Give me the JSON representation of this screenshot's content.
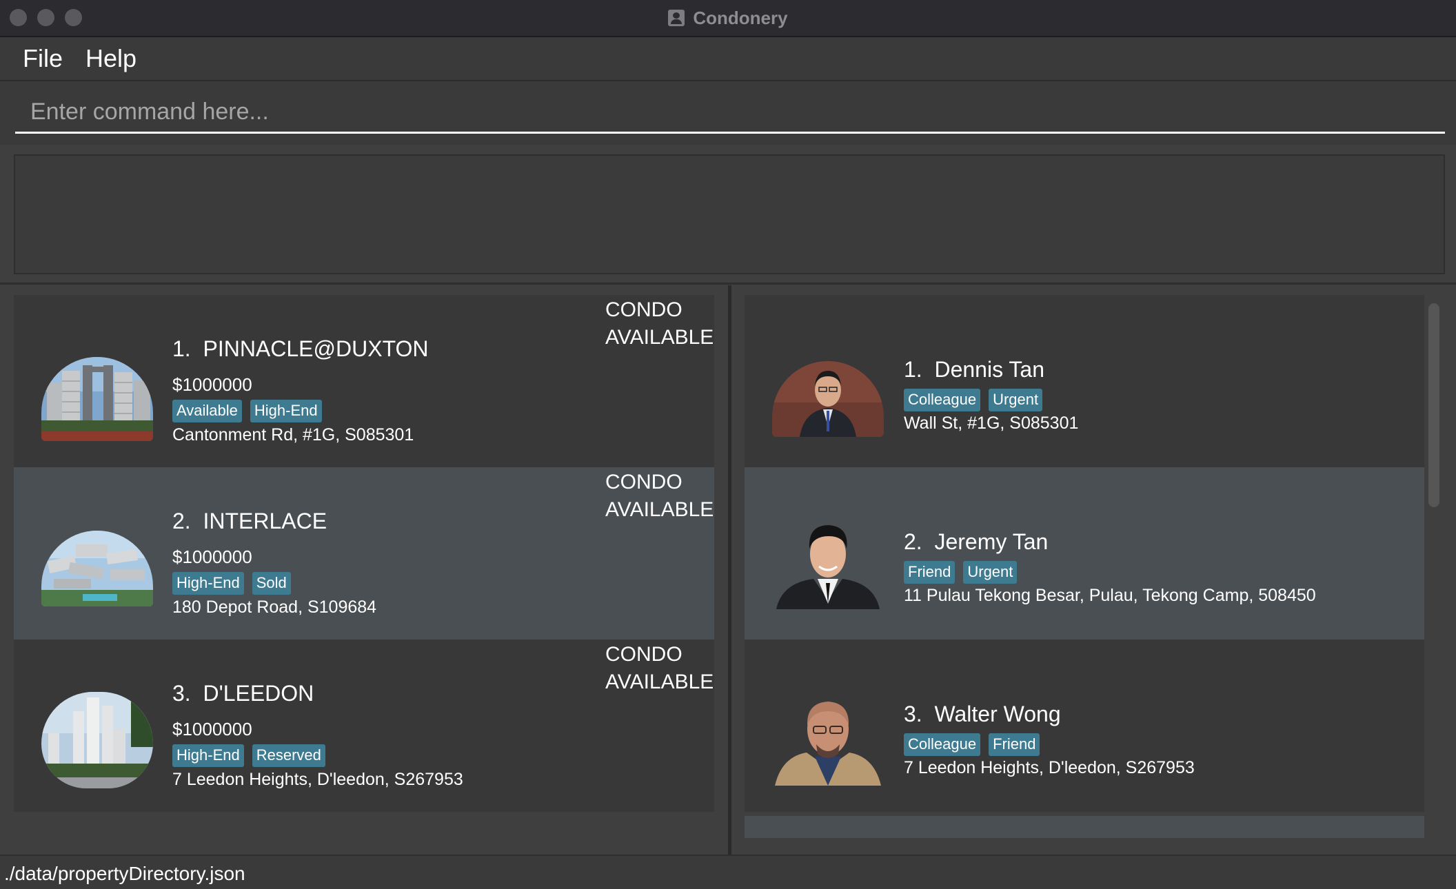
{
  "window": {
    "title": "Condonery"
  },
  "menu": {
    "items": [
      "File",
      "Help"
    ]
  },
  "command": {
    "placeholder": "Enter command here..."
  },
  "properties": [
    {
      "index": "1.",
      "name": "PINNACLE@DUXTON",
      "price": "$1000000",
      "tags": [
        "Available",
        "High-End"
      ],
      "address": "Cantonment Rd, #1G, S085301",
      "type_line1": "CONDO",
      "type_line2": "AVAILABLE"
    },
    {
      "index": "2.",
      "name": "INTERLACE",
      "price": "$1000000",
      "tags": [
        "High-End",
        "Sold"
      ],
      "address": "180 Depot Road, S109684",
      "type_line1": "CONDO",
      "type_line2": "AVAILABLE"
    },
    {
      "index": "3.",
      "name": "D'LEEDON",
      "price": "$1000000",
      "tags": [
        "High-End",
        "Reserved"
      ],
      "address": "7 Leedon Heights, D'leedon, S267953",
      "type_line1": "CONDO",
      "type_line2": "AVAILABLE"
    }
  ],
  "clients": [
    {
      "index": "1.",
      "name": "Dennis Tan",
      "tags": [
        "Colleague",
        "Urgent"
      ],
      "address": "Wall St, #1G, S085301"
    },
    {
      "index": "2.",
      "name": "Jeremy Tan",
      "tags": [
        "Friend",
        "Urgent"
      ],
      "address": "11 Pulau Tekong Besar, Pulau, Tekong Camp, 508450"
    },
    {
      "index": "3.",
      "name": "Walter Wong",
      "tags": [
        "Colleague",
        "Friend"
      ],
      "address": "7 Leedon Heights, D'leedon, S267953"
    }
  ],
  "status": {
    "file_path": "./data/propertyDirectory.json"
  },
  "colors": {
    "tag": "#3e7b91",
    "card_dark": "#383838",
    "card_selected": "#4a4f53"
  }
}
